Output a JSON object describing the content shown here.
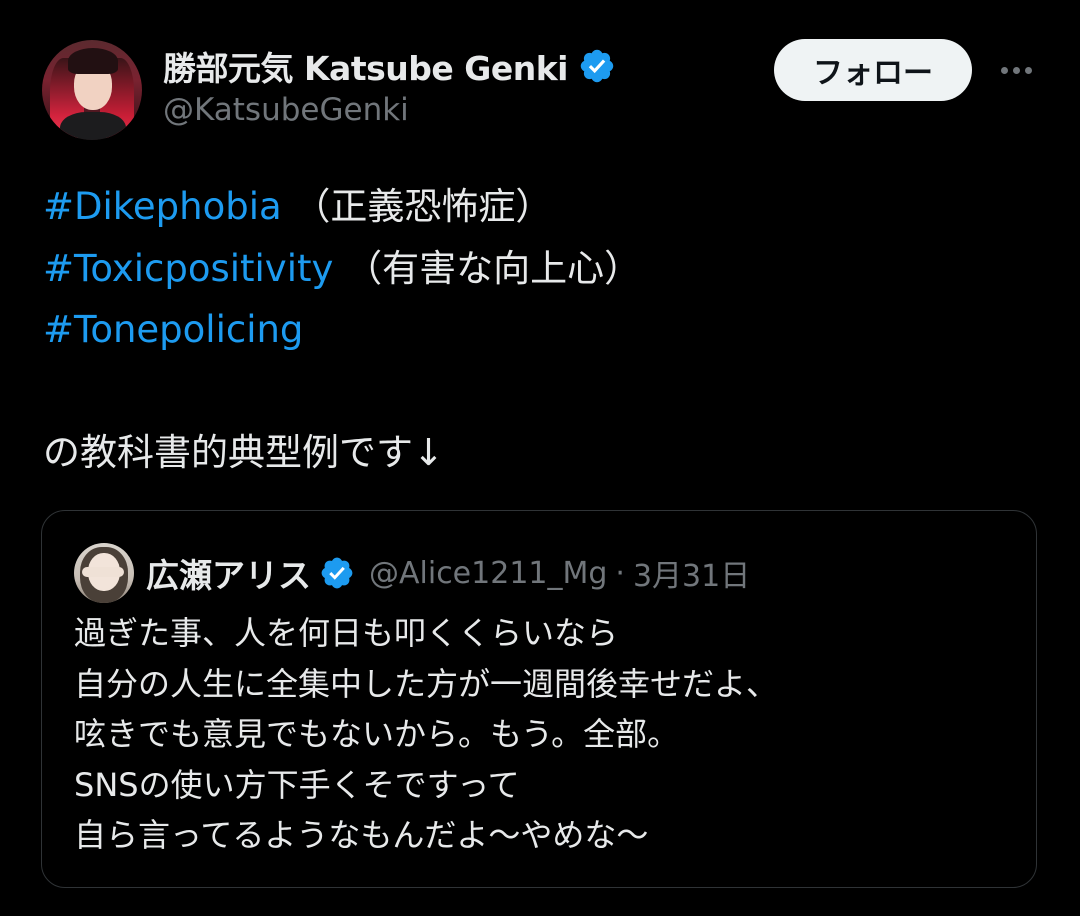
{
  "colors": {
    "background": "#000000",
    "text": "#e7e9ea",
    "secondary": "#71767b",
    "link": "#1d9bf0",
    "verified": "#1d9bf0",
    "border": "#2f3336",
    "follow_bg": "#eff3f4"
  },
  "author": {
    "display_name": "勝部元気 Katsube Genki",
    "handle": "@KatsubeGenki",
    "verified_icon": "verified-badge-icon"
  },
  "actions": {
    "follow_label": "フォロー",
    "more_icon": "more-horizontal-icon"
  },
  "body": {
    "lines": [
      {
        "hashtag": "#Dikephobia",
        "suffix": " （正義恐怖症）"
      },
      {
        "hashtag": "#Toxicpositivity",
        "suffix": " （有害な向上心）"
      },
      {
        "hashtag": "#Tonepolicing",
        "suffix": ""
      }
    ],
    "closing": "の教科書的典型例です↓"
  },
  "quote": {
    "display_name": "広瀬アリス",
    "handle": "@Alice1211_Mg",
    "separator": "·",
    "date": "3月31日",
    "verified_icon": "verified-badge-icon",
    "lines": [
      "過ぎた事、人を何日も叩くくらいなら",
      "自分の人生に全集中した方が一週間後幸せだよ、",
      "呟きでも意見でもないから。もう。全部。",
      "SNSの使い方下手くそですって",
      "自ら言ってるようなもんだよ〜やめな〜"
    ]
  }
}
